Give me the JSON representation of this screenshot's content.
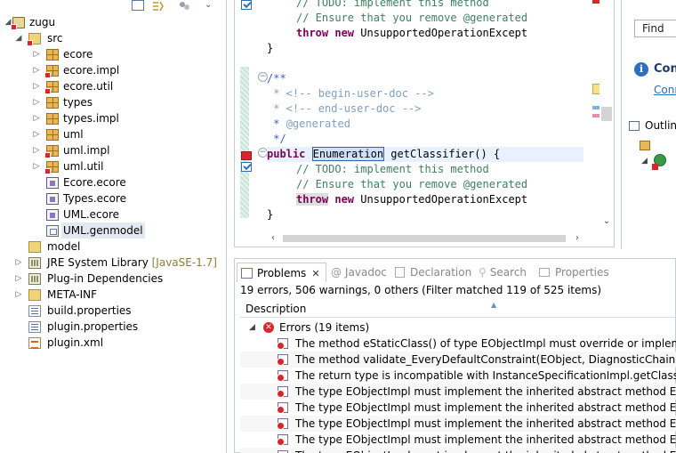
{
  "explorer": {
    "project": "zugu",
    "src": "src",
    "items": [
      {
        "label": "ecore",
        "type": "package",
        "error": false,
        "indent": 2
      },
      {
        "label": "ecore.impl",
        "type": "package",
        "error": true,
        "indent": 2
      },
      {
        "label": "ecore.util",
        "type": "package",
        "error": true,
        "indent": 2
      },
      {
        "label": "types",
        "type": "package",
        "error": false,
        "indent": 2
      },
      {
        "label": "types.impl",
        "type": "package",
        "error": false,
        "indent": 2
      },
      {
        "label": "uml",
        "type": "package",
        "error": false,
        "indent": 2
      },
      {
        "label": "uml.impl",
        "type": "package",
        "error": true,
        "indent": 2
      },
      {
        "label": "uml.util",
        "type": "package",
        "error": true,
        "indent": 2
      },
      {
        "label": "Ecore.ecore",
        "type": "ecore",
        "error": false,
        "indent": 2
      },
      {
        "label": "Types.ecore",
        "type": "ecore",
        "error": false,
        "indent": 2
      },
      {
        "label": "UML.ecore",
        "type": "ecore",
        "error": false,
        "indent": 2
      },
      {
        "label": "UML.genmodel",
        "type": "genmodel",
        "error": false,
        "indent": 2,
        "selected": true
      }
    ],
    "model": "model",
    "jre": "JRE System Library",
    "jre_decor": "[JavaSE-1.7]",
    "plugin_deps": "Plug-in Dependencies",
    "meta_inf": "META-INF",
    "build_props": "build.properties",
    "plugin_props": "plugin.properties",
    "plugin_xml": "plugin.xml"
  },
  "editor": {
    "lines": [
      {
        "text": "// TODO: implement this method",
        "kind": "comment-top"
      },
      {
        "text": "// Ensure that you remove @generated",
        "kind": "comment"
      },
      {
        "throw": "throw",
        "new": "new",
        "rest": "UnsupportedOperationExcept",
        "kind": "throw"
      },
      {
        "text": "}",
        "kind": "brace"
      },
      {
        "text": "/**",
        "kind": "doc"
      },
      {
        "text": " * <!-- begin-user-doc -->",
        "kind": "doc"
      },
      {
        "text": " * <!-- end-user-doc -->",
        "kind": "doc"
      },
      {
        "star": " * ",
        "tag": "@generated",
        "kind": "doctag"
      },
      {
        "text": " */",
        "kind": "doc"
      },
      {
        "public": "public",
        "sel": "Enumeration",
        "rest": " getClassifier() {",
        "kind": "sig"
      },
      {
        "text": "// TODO: implement this method",
        "kind": "comment"
      },
      {
        "text": "// Ensure that you remove @generated",
        "kind": "comment"
      },
      {
        "throw": "throw",
        "new": "new",
        "rest": "UnsupportedOperationExcept",
        "kind": "throw2"
      },
      {
        "text": "}",
        "kind": "brace"
      }
    ]
  },
  "right": {
    "find": "Find",
    "connect_title": "Con",
    "connect_link": "Conn",
    "outline": "Outlin"
  },
  "problems": {
    "tabs": [
      {
        "label": "Problems",
        "active": true,
        "close": "✕"
      },
      {
        "label": "Javadoc"
      },
      {
        "label": "Declaration"
      },
      {
        "label": "Search"
      },
      {
        "label": "Properties"
      }
    ],
    "summary": "19 errors, 506 warnings, 0 others (Filter matched 119 of 525 items)",
    "column": "Description",
    "group": "Errors (19 items)",
    "rows": [
      "The method eStaticClass() of type EObjectImpl must override or implement a sup",
      "The method validate_EveryDefaultConstraint(EObject, DiagnosticChain, Map<Obj",
      "The return type is incompatible with InstanceSpecificationImpl.getClassifier()",
      "The type EObjectImpl must implement the inherited abstract method EObject.eAl",
      "The type EObjectImpl must implement the inherited abstract method EObject.eCl",
      "The type EObjectImpl must implement the inherited abstract method EObject.eCo",
      "The type EObjectImpl must implement the inherited abstract method EObject.eCo",
      "The type EObjectImpl must implement the inherited abstract method EObject.eCr"
    ]
  }
}
